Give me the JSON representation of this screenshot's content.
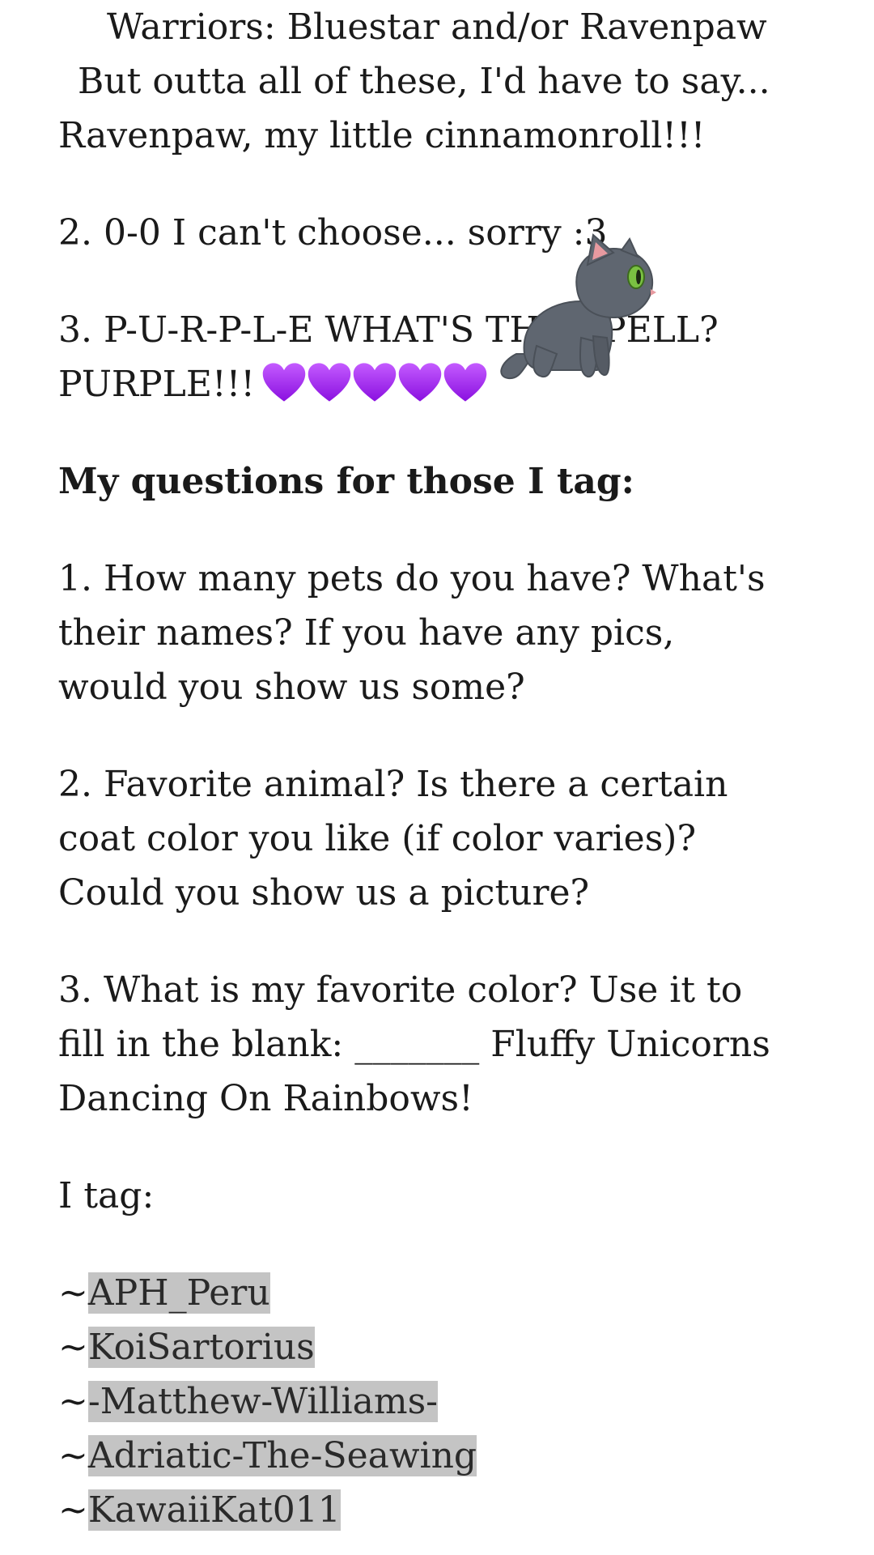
{
  "post": {
    "lines_top": [
      "Warriors: Bluestar and/or Ravenpaw",
      "But outta all of these, I'd have to say...",
      "Ravenpaw, my little cinnamonroll!!!"
    ],
    "answer2": "2. 0-0 I can't choose... sorry :3",
    "answer3_line1": "3. P-U-R-P-L-E WHAT'S THE SPELL?",
    "answer3_line2": "PURPLE!!!",
    "questions_heading": "My questions for those I tag:",
    "q1": [
      "1. How many pets do you have? What's",
      "their names? If you have any pics,",
      "would you show us some?"
    ],
    "q2": [
      "2. Favorite animal? Is there a certain",
      "coat color you like (if color varies)?",
      "Could you show us a picture?"
    ],
    "q3": [
      "3. What is my favorite color? Use it to",
      "fill in the blank: _______ Fluffy Unicorns",
      "Dancing On Rainbows!"
    ],
    "tag_label": "I tag:",
    "tag_prefix": "~",
    "tags": [
      "APH_Peru",
      "KoiSartorius",
      "-Matthew-Williams-",
      "Adriatic-The-Seawing",
      "KawaiiKat011"
    ]
  },
  "colors": {
    "heart": "#a020f0",
    "mention_bg": "#c4c4c4",
    "cat_body": "#5f6670",
    "cat_eye": "#7ac142"
  },
  "icons": {
    "heart": "purple-heart-icon",
    "sticker": "gray-cat-sticker"
  }
}
